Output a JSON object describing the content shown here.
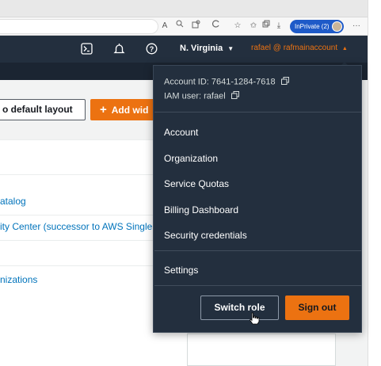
{
  "browser": {
    "inprivate_label": "InPrivate (2)",
    "toolbar_icons": [
      "read-aloud-icon",
      "zoom-icon",
      "extensions-icon",
      "refresh-icon",
      "favorite-icon",
      "favorites-icon",
      "collections-icon",
      "downloads-icon",
      "more-icon"
    ]
  },
  "aws_nav": {
    "region": "N. Virginia",
    "account_menu": "rafael @ rafmainaccount",
    "icons": [
      "cloudshell-icon",
      "notifications-icon",
      "help-icon"
    ]
  },
  "content": {
    "default_layout_label": "o default layout",
    "add_widget_label": "Add wid",
    "links": [
      "atalog",
      "ity Center (successor to AWS Single S",
      "nizations"
    ]
  },
  "account_dropdown": {
    "account_id": "Account ID: 7641-1284-7618",
    "iam_user": "IAM user: rafael",
    "menu_items": [
      "Account",
      "Organization",
      "Service Quotas",
      "Billing Dashboard",
      "Security credentials"
    ],
    "settings": "Settings",
    "switch_role": "Switch role",
    "sign_out": "Sign out"
  },
  "colors": {
    "nav_bg": "#232f3e",
    "accent_orange": "#ec7211",
    "link_blue": "#0073bb",
    "inprivate_blue": "#1e5ac8"
  }
}
